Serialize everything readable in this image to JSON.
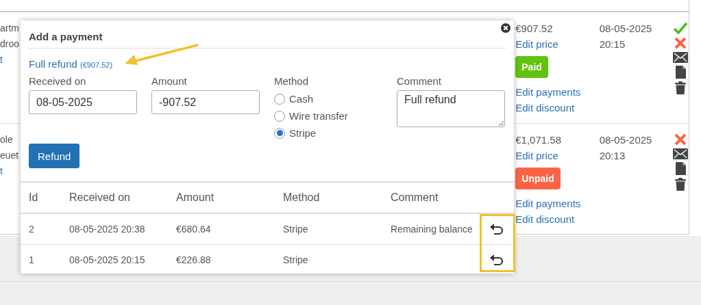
{
  "orders": [
    {
      "name_lines": [
        "artm",
        "droo"
      ],
      "name_link": "t",
      "price": "€907.52",
      "edit_price": "Edit price",
      "status": {
        "label": "Paid",
        "kind": "paid"
      },
      "edit_payments": "Edit payments",
      "edit_discount": "Edit discount",
      "date": "08-05-2025",
      "time": "20:15",
      "actions": [
        {
          "kind": "approve"
        },
        {
          "kind": "reject"
        },
        {
          "kind": "email"
        },
        {
          "kind": "document"
        },
        {
          "kind": "delete"
        }
      ]
    },
    {
      "name_lines": [
        "ole",
        "euet"
      ],
      "name_link": "t",
      "price": "€1,071.58",
      "edit_price": "Edit price",
      "status": {
        "label": "Unpaid",
        "kind": "unpaid"
      },
      "edit_payments": "Edit payments",
      "edit_discount": "Edit discount",
      "date": "08-05-2025",
      "time": "20:13",
      "actions": [
        {
          "kind": "reject"
        },
        {
          "kind": "email"
        },
        {
          "kind": "document"
        },
        {
          "kind": "delete"
        }
      ]
    }
  ],
  "dialog": {
    "title": "Add a payment",
    "full_refund": {
      "label": "Full refund",
      "amount": "(€907.52)"
    },
    "fields": {
      "received_on": {
        "label": "Received on",
        "value": "08-05-2025"
      },
      "amount": {
        "label": "Amount",
        "value": "-907.52"
      },
      "method": {
        "label": "Method",
        "options": [
          {
            "label": "Cash",
            "selected": false
          },
          {
            "label": "Wire transfer",
            "selected": false
          },
          {
            "label": "Stripe",
            "selected": true
          }
        ]
      },
      "comment": {
        "label": "Comment",
        "value": "Full refund"
      }
    },
    "submit": "Refund",
    "payments": {
      "columns": [
        "Id",
        "Received on",
        "Amount",
        "Method",
        "Comment"
      ],
      "rows": [
        {
          "id": "2",
          "received_on": "08-05-2025 20:38",
          "amount": "€680.64",
          "method": "Stripe",
          "comment": "Remaining balance"
        },
        {
          "id": "1",
          "received_on": "08-05-2025 20:15",
          "amount": "€226.88",
          "method": "Stripe"
        }
      ]
    }
  }
}
